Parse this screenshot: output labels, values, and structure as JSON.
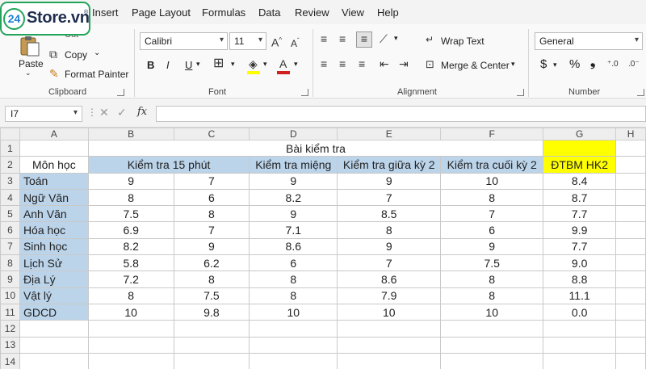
{
  "logo": {
    "badge": "24",
    "text": "Store.vn",
    "reg": "®"
  },
  "menu": [
    "Insert",
    "Page Layout",
    "Formulas",
    "Data",
    "Review",
    "View",
    "Help"
  ],
  "ribbon": {
    "clipboard": {
      "label": "Clipboard",
      "paste": "Paste",
      "cut": "Cut",
      "copy": "Copy",
      "format_painter": "Format Painter"
    },
    "font": {
      "label": "Font",
      "family": "Calibri",
      "size": "11",
      "bold": "B",
      "italic": "I",
      "underline": "U"
    },
    "alignment": {
      "label": "Alignment",
      "wrap_text": "Wrap Text",
      "merge_center": "Merge & Center"
    },
    "number": {
      "label": "Number",
      "format": "General",
      "currency": "$",
      "percent": "%",
      "comma": "❟"
    }
  },
  "formula_bar": {
    "name_box": "I7",
    "fx": "fx",
    "value": ""
  },
  "columns": [
    "A",
    "B",
    "C",
    "D",
    "E",
    "F",
    "G",
    "H"
  ],
  "sheet": {
    "title": "Bài kiểm tra",
    "subject_header": "Môn học",
    "headers": [
      "Kiểm tra 15 phút",
      "Kiểm tra miệng",
      "Kiểm tra giữa kỳ 2",
      "Kiểm tra cuối kỳ 2",
      "ĐTBM HK2"
    ],
    "rows": [
      {
        "n": "3",
        "subject": "Toán",
        "b": "9",
        "c": "7",
        "d": "9",
        "e": "9",
        "f": "10",
        "g": "8.4"
      },
      {
        "n": "4",
        "subject": "Ngữ Văn",
        "b": "8",
        "c": "6",
        "d": "8.2",
        "e": "7",
        "f": "8",
        "g": "8.7"
      },
      {
        "n": "5",
        "subject": "Anh Văn",
        "b": "7.5",
        "c": "8",
        "d": "9",
        "e": "8.5",
        "f": "7",
        "g": "7.7"
      },
      {
        "n": "6",
        "subject": "Hóa học",
        "b": "6.9",
        "c": "7",
        "d": "7.1",
        "e": "8",
        "f": "6",
        "g": "9.9"
      },
      {
        "n": "7",
        "subject": "Sinh học",
        "b": "8.2",
        "c": "9",
        "d": "8.6",
        "e": "9",
        "f": "9",
        "g": "7.7"
      },
      {
        "n": "8",
        "subject": "Lịch Sử",
        "b": "5.8",
        "c": "6.2",
        "d": "6",
        "e": "7",
        "f": "7.5",
        "g": "9.0"
      },
      {
        "n": "9",
        "subject": "Địa Lý",
        "b": "7.2",
        "c": "8",
        "d": "8",
        "e": "8.6",
        "f": "8",
        "g": "8.8"
      },
      {
        "n": "10",
        "subject": "Vật lý",
        "b": "8",
        "c": "7.5",
        "d": "8",
        "e": "7.9",
        "f": "8",
        "g": "11.1"
      },
      {
        "n": "11",
        "subject": "GDCD",
        "b": "10",
        "c": "9.8",
        "d": "10",
        "e": "10",
        "f": "10",
        "g": "0.0"
      }
    ],
    "empty_rows": [
      "12",
      "13",
      "14"
    ]
  },
  "colors": {
    "header_fill": "#bcd4ea",
    "gpa_fill": "#ffff00",
    "logo_green": "#22a55a",
    "logo_blue": "#1e7fd6"
  }
}
